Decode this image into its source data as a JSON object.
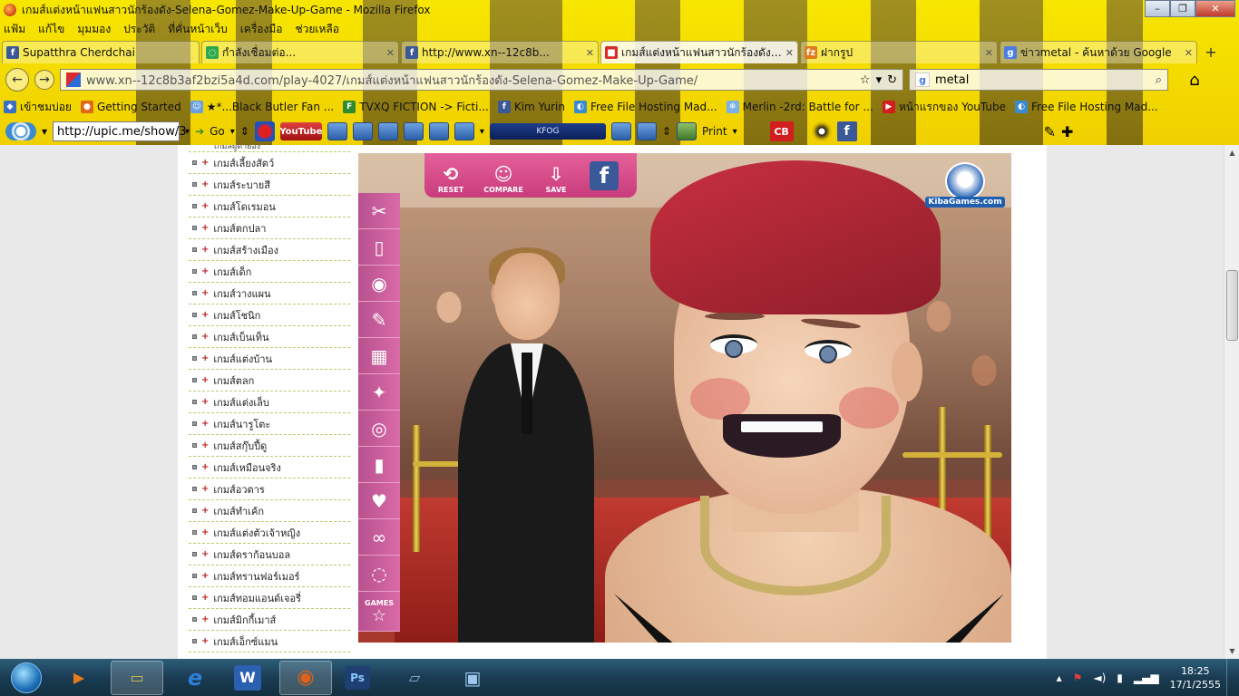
{
  "window": {
    "title": "เกมส์แต่งหน้าแฟนสาวนักร้องดัง-Selena-Gomez-Make-Up-Game - Mozilla Firefox",
    "minimize": "–",
    "maximize": "❐",
    "close": "✕"
  },
  "menu": {
    "items": [
      "แฟ้ม",
      "แก้ไข",
      "มุมมอง",
      "ประวัติ",
      "ที่คั่นหน้าเว็บ",
      "เครื่องมือ",
      "ช่วยเหลือ"
    ]
  },
  "tabs": [
    {
      "label": "Supatthra Cherdchai",
      "icon": "facebook-icon",
      "color": "#3b5998",
      "glyph": "f"
    },
    {
      "label": "กำลังเชื่อมต่อ...",
      "icon": "loading-icon",
      "color": "#2fa84f",
      "glyph": "◌"
    },
    {
      "label": "http://www.xn--12c8b...",
      "icon": "facebook-icon",
      "color": "#3b5998",
      "glyph": "f"
    },
    {
      "label": "เกมส์แต่งหน้าแฟนสาวนักร้องดัง-S...",
      "icon": "site-icon",
      "color": "#d82c2c",
      "glyph": "■",
      "active": true
    },
    {
      "label": "ฝากรูป",
      "icon": "upload-site-icon",
      "color": "#e07b1a",
      "glyph": "fz"
    },
    {
      "label": "ข่าวmetal - ค้นหาด้วย Google",
      "icon": "google-icon",
      "color": "#4a7de0",
      "glyph": "g"
    }
  ],
  "newtab": "+",
  "nav": {
    "url": "www.xn--12c8b3af2bzi5a4d.com/play-4027/เกมส์แต่งหน้าแฟนสาวนักร้องดัง-Selena-Gomez-Make-Up-Game/",
    "search_value": "metal",
    "back": "←",
    "forward": "→",
    "reload": "↻",
    "star": "☆",
    "home": "⌂"
  },
  "bookmarks": [
    {
      "label": "เข้าชมบ่อย",
      "color": "#3a6fc4",
      "glyph": "◆"
    },
    {
      "label": "Getting Started",
      "color": "#e06a1a",
      "glyph": "●"
    },
    {
      "label": "★*...Black Butler Fan ...",
      "color": "#6aa0e0",
      "glyph": "☺"
    },
    {
      "label": "TVXQ FICTION -> Ficti...",
      "color": "#2e8a2e",
      "glyph": "F"
    },
    {
      "label": "Kim Yurin",
      "color": "#3b5998",
      "glyph": "f"
    },
    {
      "label": "Free File Hosting Mad...",
      "color": "#3a8ad0",
      "glyph": "◐"
    },
    {
      "label": "Merlin -2rd: Battle for ...",
      "color": "#7ab0e8",
      "glyph": "❄"
    },
    {
      "label": "หน้าแรกของ YouTube",
      "color": "#d21e1e",
      "glyph": "▶"
    },
    {
      "label": "Free File Hosting Mad...",
      "color": "#3a8ad0",
      "glyph": "◐"
    }
  ],
  "toolbar2": {
    "upic_value": "http://upic.me/show/3",
    "go_label": "Go",
    "youtube_label": "YouTube",
    "radio_label": "KFOG",
    "print_label": "Print",
    "cb_label": "CB",
    "fb_label": "f"
  },
  "sidebar": {
    "cut_item": "เกมส์ผู้ตายอง",
    "items": [
      "เกมส์เลี้ยงสัตว์",
      "เกมส์ระบายสี",
      "เกมส์โดเรมอน",
      "เกมส์ตกปลา",
      "เกมส์สร้างเมือง",
      "เกมส์เด็ก",
      "เกมส์วางแผน",
      "เกมส์โชนิก",
      "เกมส์เบ็นเท็น",
      "เกมส์แต่งบ้าน",
      "เกมส์ตลก",
      "เกมส์แต่งเล็บ",
      "เกมส์นารูโตะ",
      "เกมส์สกุ๊บปี้ดู",
      "เกมส์เหมือนจริง",
      "เกมส์อวตาร",
      "เกมส์ทำเค้ก",
      "เกมส์แต่งตัวเจ้าหญิง",
      "เกมส์ดราก้อนบอล",
      "เกมส์ทรานฟอร์เมอร์",
      "เกมส์ทอมแอนด์เจอรี่",
      "เกมส์มิกกี้เมาส์",
      "เกมส์เอ็กซ์แมน"
    ]
  },
  "game": {
    "top_buttons": [
      {
        "label": "RESET",
        "glyph": "⟲",
        "icon": "reset-icon"
      },
      {
        "label": "COMPARE",
        "glyph": "☺",
        "icon": "compare-icon"
      },
      {
        "label": "SAVE",
        "glyph": "⇩",
        "icon": "save-icon"
      }
    ],
    "facebook_glyph": "f",
    "tools": [
      {
        "glyph": "✂",
        "icon": "scissors-icon"
      },
      {
        "glyph": "▯",
        "icon": "cream-tube-icon"
      },
      {
        "glyph": "◉",
        "icon": "eye-icon"
      },
      {
        "glyph": "✎",
        "icon": "eyeliner-icon"
      },
      {
        "glyph": "▦",
        "icon": "palette-icon"
      },
      {
        "glyph": "✦",
        "icon": "brush-icon"
      },
      {
        "glyph": "◎",
        "icon": "powder-icon"
      },
      {
        "glyph": "▮",
        "icon": "lipstick-icon"
      },
      {
        "glyph": "♥",
        "icon": "shirt-icon"
      },
      {
        "glyph": "∞",
        "icon": "glasses-icon"
      },
      {
        "glyph": "◌",
        "icon": "earring-icon"
      }
    ],
    "games_label": "GAMES",
    "games_glyph": "☆",
    "brand": "KibaGames.com"
  },
  "taskbar": {
    "apps": [
      {
        "icon": "media-player-icon",
        "glyph": "▶",
        "color": "#e87a1a"
      },
      {
        "icon": "explorer-icon",
        "glyph": "▭",
        "color": "#e0b85a",
        "selected": true
      },
      {
        "icon": "internet-explorer-icon",
        "glyph": "e",
        "color": "#2f7ed8"
      },
      {
        "icon": "word-icon",
        "glyph": "W",
        "color": "#2b5fb0"
      },
      {
        "icon": "firefox-icon",
        "glyph": "◉",
        "color": "#e0621a",
        "selected": true
      },
      {
        "icon": "photoshop-icon",
        "glyph": "Ps",
        "color": "#1f3e72"
      },
      {
        "icon": "notes-icon",
        "glyph": "▱",
        "color": "#8ab4d8"
      },
      {
        "icon": "photo-viewer-icon",
        "glyph": "▣",
        "color": "#5f8fc0"
      }
    ],
    "time": "18:25",
    "date": "17/1/2555"
  }
}
